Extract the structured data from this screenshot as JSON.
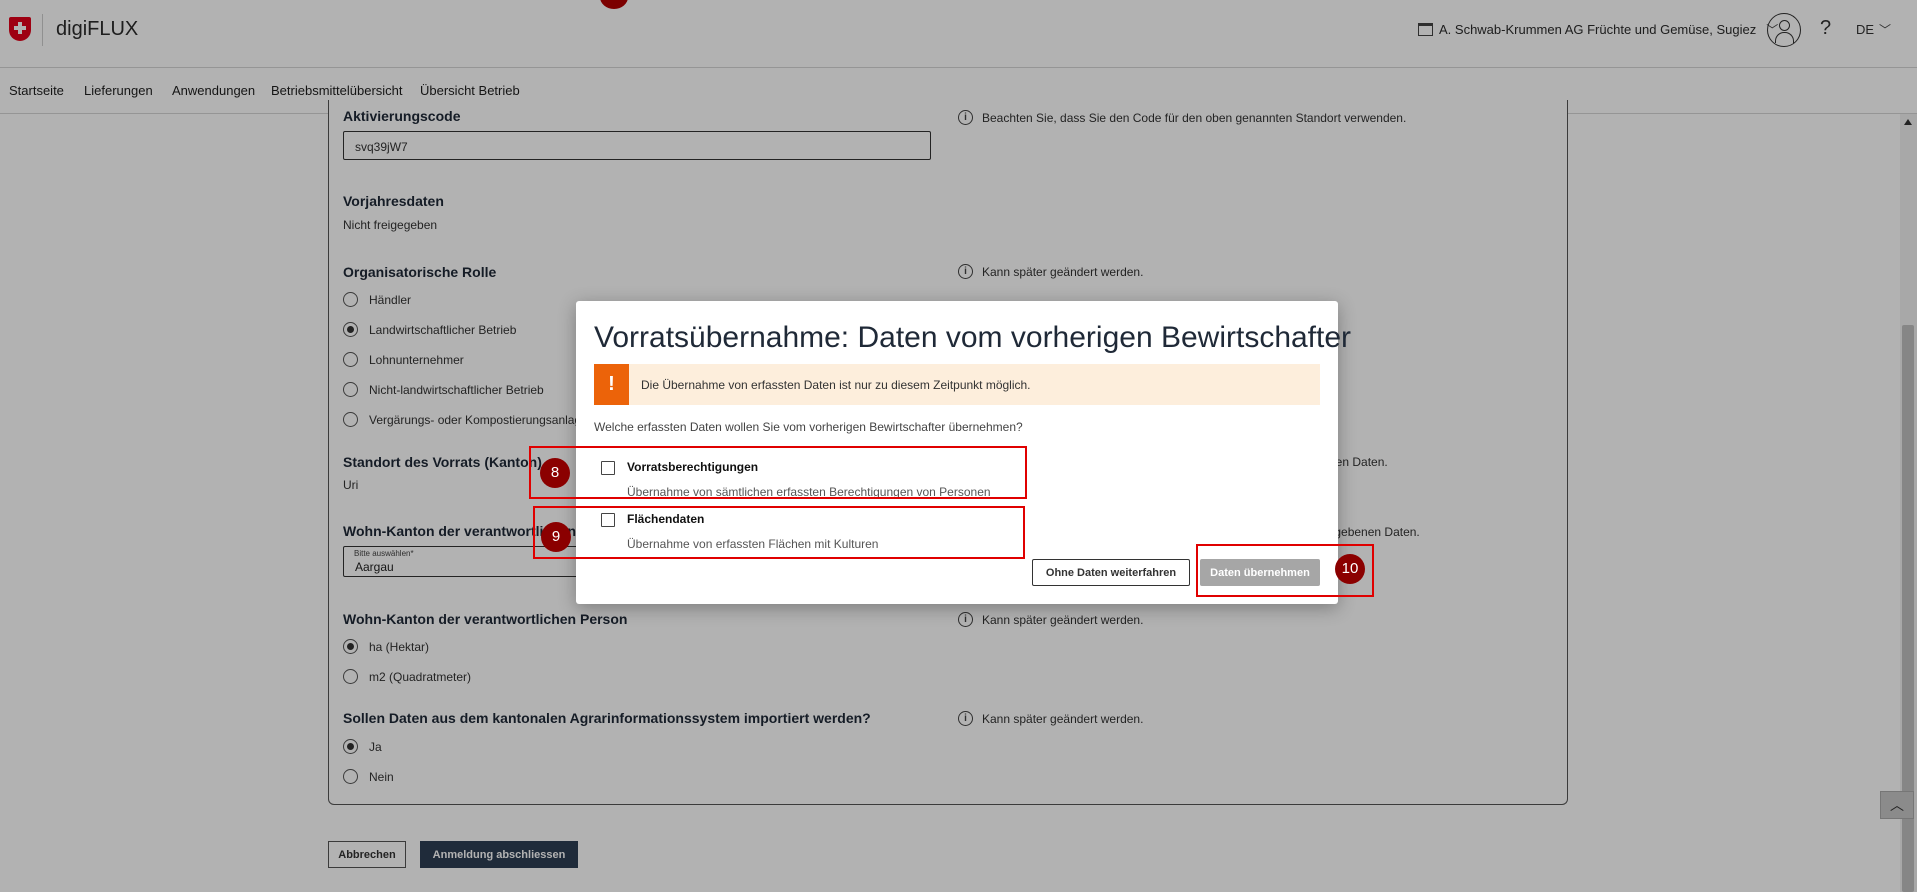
{
  "header": {
    "app_title": "digiFLUX",
    "organization": "A. Schwab-Krummen AG Früchte und Gemüse, Sugiez",
    "help": "?",
    "language": "DE"
  },
  "nav": {
    "items": [
      "Startseite",
      "Lieferungen",
      "Anwendungen",
      "Betriebsmittelübersicht",
      "Übersicht Betrieb"
    ]
  },
  "form": {
    "activation": {
      "label": "Aktivierungscode",
      "value": "svq39jW7",
      "info": "Beachten Sie, dass Sie den Code für den oben genannten Standort verwenden."
    },
    "prev_year": {
      "label": "Vorjahresdaten",
      "value": "Nicht freigegeben"
    },
    "role": {
      "label": "Organisatorische Rolle",
      "info": "Kann später geändert werden.",
      "options": [
        "Händler",
        "Landwirtschaftlicher Betrieb",
        "Lohnunternehmer",
        "Nicht-landwirtschaftlicher Betrieb",
        "Vergärungs- oder Kompostierungsanlage"
      ],
      "selected_index": 1
    },
    "canton": {
      "label": "Standort des Vorrats (Kanton)",
      "value": "Uri",
      "info_tail": "nen Daten."
    },
    "residence": {
      "label": "Wohn-Kanton der verantwortlichen Person",
      "select_label": "Bitte auswählen*",
      "value": "Aargau",
      "info_tail": "gegebenen Daten."
    },
    "unit": {
      "label": "Wohn-Kanton der verantwortlichen Person",
      "info": "Kann später geändert werden.",
      "options": [
        "ha (Hektar)",
        "m2 (Quadratmeter)"
      ],
      "selected_index": 0
    },
    "import": {
      "label": "Sollen Daten aus dem kantonalen Agrarinformationssystem importiert werden?",
      "info": "Kann später geändert werden.",
      "options": [
        "Ja",
        "Nein"
      ],
      "selected_index": 0
    },
    "buttons": {
      "cancel": "Abbrechen",
      "finish": "Anmeldung abschliessen"
    }
  },
  "modal": {
    "title": "Vorratsübernahme: Daten vom vorherigen Bewirtschafter",
    "alert_icon": "!",
    "alert": "Die Übernahme von erfassten Daten ist nur zu diesem Zeitpunkt möglich.",
    "question": "Welche erfassten Daten wollen Sie vom vorherigen Bewirtschafter übernehmen?",
    "options": [
      {
        "title": "Vorratsberechtigungen",
        "desc": "Übernahme von sämtlichen erfassten Berechtigungen von Personen",
        "checked": false
      },
      {
        "title": "Flächendaten",
        "desc": "Übernahme von erfassten Flächen mit Kulturen",
        "checked": false
      }
    ],
    "buttons": {
      "skip": "Ohne Daten weiterfahren",
      "apply": "Daten übernehmen"
    }
  },
  "annotations": [
    "8",
    "9",
    "10"
  ],
  "colors": {
    "alert_accent": "#ec6309",
    "alert_bg": "#fdeedc",
    "primary_button": "#2d3e54",
    "disabled_button": "#a6a6a6",
    "annotation_red": "#e00000",
    "logo_red": "#e2001a"
  },
  "icons": [
    "swiss-cross-logo",
    "building-icon",
    "user-icon",
    "help-icon",
    "chevron-down-icon",
    "info-icon",
    "warning-icon",
    "checkbox",
    "radio",
    "scroll-to-top-icon"
  ]
}
